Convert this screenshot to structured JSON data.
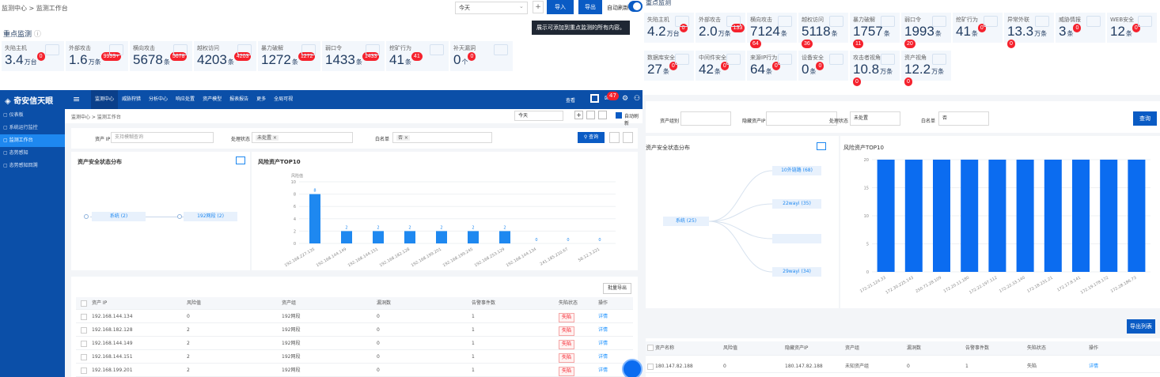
{
  "tl": {
    "breadcrumb": "监测中心 > 监测工作台",
    "date_value": "今天",
    "plus": "+",
    "import_label": "导入",
    "export_label": "导出",
    "auto_refresh": "自动刷新",
    "tooltip": "展示可添加到重点监测的所有内容。",
    "section_title": "重点监测",
    "cards": [
      {
        "label": "失陷主机",
        "value": "3.4",
        "unit": "万台",
        "badge": "0"
      },
      {
        "label": "外部攻击",
        "value": "1.6",
        "unit": "万条",
        "badge": "9999+"
      },
      {
        "label": "横向攻击",
        "value": "5678",
        "unit": "条",
        "badge": "5678"
      },
      {
        "label": "越权访问",
        "value": "4203",
        "unit": "条",
        "badge": "4203"
      },
      {
        "label": "暴力破解",
        "value": "1272",
        "unit": "条",
        "badge": "1272"
      },
      {
        "label": "弱口令",
        "value": "1433",
        "unit": "条",
        "badge": "1433"
      },
      {
        "label": "挖矿行为",
        "value": "41",
        "unit": "条",
        "badge": "41"
      },
      {
        "label": "补天漏洞",
        "value": "0",
        "unit": "个",
        "badge": "0"
      }
    ]
  },
  "tr": {
    "section_title": "重点监测",
    "row1": [
      {
        "label": "失陷主机",
        "value": "4.2",
        "unit": "万台",
        "badge": "0"
      },
      {
        "label": "外部攻击",
        "value": "2.0",
        "unit": "万条",
        "badge": "133"
      },
      {
        "label": "横向攻击",
        "value": "7124",
        "unit": "条",
        "badge": "64"
      },
      {
        "label": "越权访问",
        "value": "5118",
        "unit": "条",
        "badge": "36"
      },
      {
        "label": "暴力破解",
        "value": "1757",
        "unit": "条",
        "badge": "11"
      },
      {
        "label": "弱口令",
        "value": "1993",
        "unit": "条",
        "badge": "20"
      },
      {
        "label": "挖矿行为",
        "value": "41",
        "unit": "条",
        "badge": "0"
      },
      {
        "label": "异常外联",
        "value": "13.3",
        "unit": "万条",
        "badge": "0"
      },
      {
        "label": "威胁情报",
        "value": "3",
        "unit": "条",
        "badge": "0"
      },
      {
        "label": "WEB安全",
        "value": "12",
        "unit": "条",
        "badge": "0"
      }
    ],
    "row2": [
      {
        "label": "数据库安全",
        "value": "27",
        "unit": "条",
        "badge": "0"
      },
      {
        "label": "中间件安全",
        "value": "42",
        "unit": "条",
        "badge": "0"
      },
      {
        "label": "来源IP行为",
        "value": "64",
        "unit": "条",
        "badge": "0"
      },
      {
        "label": "设备安全",
        "value": "0",
        "unit": "条",
        "badge": "0"
      },
      {
        "label": "攻击者视角",
        "value": "10.8",
        "unit": "万条",
        "badge": "0"
      },
      {
        "label": "资产视角",
        "value": "12.2",
        "unit": "万条",
        "badge": "0"
      }
    ]
  },
  "bl": {
    "logo": "奇安信天眼",
    "nav": [
      "监测中心",
      "威胁狩猎",
      "分析中心",
      "响应处置",
      "资产模型",
      "报表报告",
      "更多",
      "全局可视"
    ],
    "header_right": [
      "查看",
      "47"
    ],
    "sidebar": [
      "仪表板",
      "系统运行监控",
      "监测工作台",
      "态势感知",
      "态势感知回溯"
    ],
    "breadcrumb": "监测中心 > 监测工作台",
    "date_value": "今天",
    "auto_refresh": "自动刷新",
    "filter": {
      "asset_ip_label": "资产 IP",
      "asset_ip_placeholder": "支持模糊查询",
      "status_label": "处理状态",
      "status_tag": "未处置 ×",
      "whitelist_label": "白名单",
      "whitelist_tag": "否 ×",
      "query": "查询"
    },
    "left_title": "资产安全状态分布",
    "nodes": [
      "系统 (2)",
      "192网段 (2)"
    ],
    "right_title": "风险资产TOP10",
    "batch_export": "批量导出",
    "columns": [
      "资产 IP",
      "风险值",
      "资产组",
      "漏洞数",
      "告警事件数",
      "失陷状态",
      "操作"
    ],
    "rows": [
      [
        "192.168.144.134",
        "0",
        "192网段",
        "0",
        "1",
        "失陷",
        "详情"
      ],
      [
        "192.168.182.128",
        "2",
        "192网段",
        "0",
        "1",
        "失陷",
        "详情"
      ],
      [
        "192.168.144.149",
        "2",
        "192网段",
        "0",
        "1",
        "失陷",
        "详情"
      ],
      [
        "192.168.144.151",
        "2",
        "192网段",
        "0",
        "1",
        "失陷",
        "详情"
      ],
      [
        "192.168.199.201",
        "2",
        "192网段",
        "0",
        "1",
        "失陷",
        "详情"
      ]
    ]
  },
  "br": {
    "filter": {
      "asset_group": "资产组别",
      "asset_ip": "隐藏资产IP",
      "status": "处理状态",
      "status_value": "未处置",
      "whitelist": "白名单",
      "whitelist_value": "否",
      "query": "查询"
    },
    "left_title": "资产安全状态分布",
    "root_node": "系统 (25)",
    "child_nodes": [
      "10外链路 (68)",
      "22wayi (35)",
      "29wayi (34)"
    ],
    "right_title": "风险资产TOP10",
    "export": "导出列表",
    "columns": [
      "资产名称",
      "风险值",
      "隐藏资产IP",
      "资产组",
      "漏洞数",
      "告警事件数",
      "失陷状态",
      "操作"
    ],
    "row": [
      "180.147.82.188",
      "0",
      "180.147.82.188",
      "未知资产组",
      "0",
      "1",
      "失陷",
      "详情"
    ]
  },
  "chart_data": [
    {
      "type": "bar",
      "title": "风险资产TOP10",
      "ylabel": "风险值",
      "categories": [
        "192.168.227.135",
        "192.168.144.149",
        "192.168.144.151",
        "192.168.182.128",
        "192.168.199.201",
        "192.168.199.245",
        "192.168.253.129",
        "192.168.144.134",
        "241.185.210.67",
        "58.12.3.221"
      ],
      "values": [
        8,
        2,
        2,
        2,
        2,
        2,
        2,
        0,
        0,
        0
      ],
      "ylim": [
        0,
        10
      ],
      "yticks": [
        0,
        2,
        4,
        6,
        8,
        10
      ],
      "color": "#1e88f0"
    },
    {
      "type": "bar",
      "title": "风险资产TOP10",
      "categories": [
        "172.21.124.33",
        "172.30.225.143",
        "250.71.28.109",
        "172.20.11.180",
        "172.22.197.112",
        "172.22.33.140",
        "172.18.231.21",
        "172.17.8.141",
        "172.19.178.172",
        "172.28.186.73"
      ],
      "values": [
        20,
        20,
        20,
        20,
        20,
        20,
        20,
        20,
        20,
        20
      ],
      "ylim": [
        0,
        20
      ],
      "yticks": [
        0,
        5,
        10,
        15,
        20
      ],
      "color": "#0b6cf0"
    }
  ]
}
